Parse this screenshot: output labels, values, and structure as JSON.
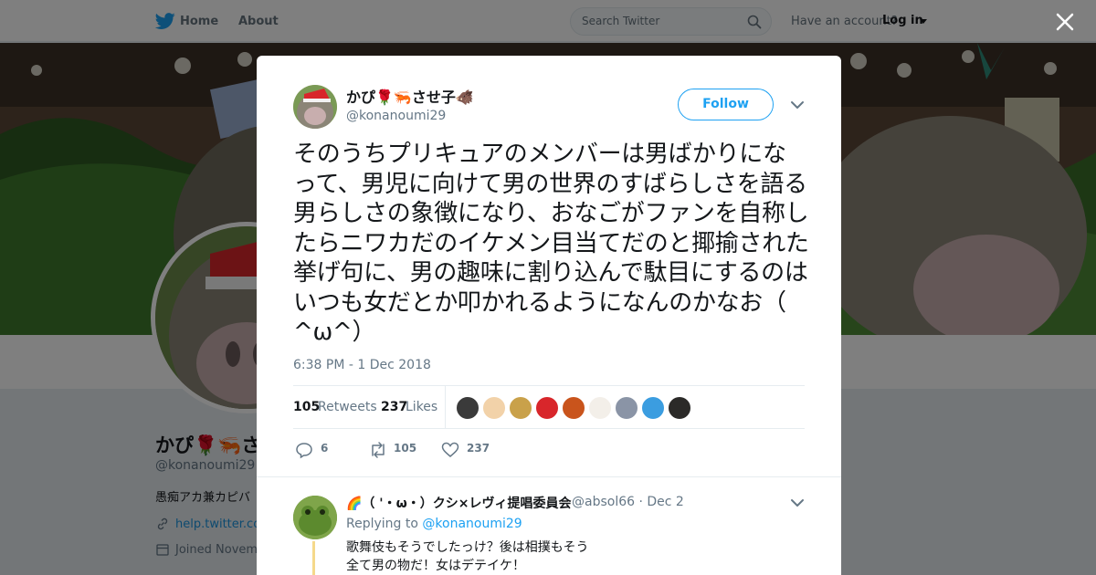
{
  "nav": {
    "home_label": "Home",
    "about_label": "About",
    "search_placeholder": "Search Twitter",
    "have_account": "Have an account?",
    "login_label": "Log in"
  },
  "profile": {
    "display_name": "かぴ🌹🦐させ子🐗",
    "handle": "@konanoumi29",
    "bio": "愚痴アカ兼カピバ",
    "link": "help.twitter.com",
    "joined": "Joined Novem"
  },
  "tweet": {
    "author_name": "かぴ🌹🦐させ子🐗",
    "author_handle": "@konanoumi29",
    "follow_label": "Follow",
    "text": "そのうちプリキュアのメンバーは男ばかりになって、男児に向けて男の世界のすばらしさを語る男らしさの象徴になり、おなごがファンを自称したらニワカだのイケメン目当てだのと揶揄された挙げ句に、男の趣味に割り込んで駄目にするのはいつも女だとか叩かれるようになんのかなお（ ^ω^）",
    "timestamp": "6:38 PM - 1 Dec 2018",
    "retweets_count": "105",
    "retweets_label": "Retweets",
    "likes_count": "237",
    "likes_label": "Likes",
    "reply_count": "6",
    "retweet_action_count": "105",
    "like_action_count": "237"
  },
  "liker_faces": [
    {
      "name": "liker-1",
      "color": "#3a3a3a"
    },
    {
      "name": "liker-2",
      "color": "#f2d2a9"
    },
    {
      "name": "liker-3",
      "color": "#c9a14a"
    },
    {
      "name": "liker-4",
      "color": "#d8262b"
    },
    {
      "name": "liker-5",
      "color": "#c9541c"
    },
    {
      "name": "liker-6",
      "color": "#f3efe9"
    },
    {
      "name": "liker-7",
      "color": "#8a94a6"
    },
    {
      "name": "liker-8",
      "color": "#3b9de0"
    },
    {
      "name": "liker-9",
      "color": "#2b2a28"
    }
  ],
  "reply": {
    "author_name": "🌈（ '・ω・）クシ×レヴィ提唱委員会",
    "author_handle": "@absol66 · Dec 2",
    "replying_prefix": "Replying to",
    "replying_to": "@konanoumi29",
    "line1": "歌舞伎もそうでしたっけ？後は相撲もそう",
    "line2": "全て男の物だ！女はデテイケ！"
  },
  "colors": {
    "accent": "#1da1f2",
    "overlay": "rgba(0,0,0,0.5)"
  }
}
